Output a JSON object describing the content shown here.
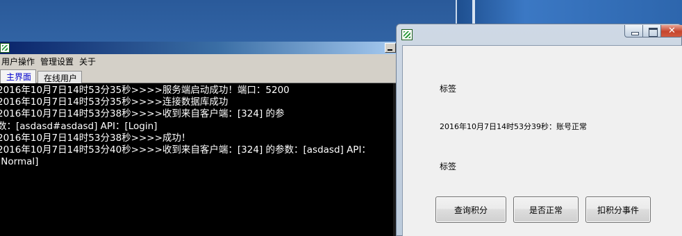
{
  "server_window": {
    "menu": [
      "用户操作",
      "管理设置",
      "关于"
    ],
    "tabs": [
      {
        "label": "主界面",
        "active": true
      },
      {
        "label": "在线用户",
        "active": false
      }
    ],
    "log_lines": [
      "2016年10月7日14时53分35秒>>>>服务端启动成功！端口：5200",
      "2016年10月7日14时53分35秒>>>>连接数据库成功",
      "2016年10月7日14时53分38秒>>>>收到来自客户端：[324] 的参",
      "数：[asdasd#asdasd] API：[Login]",
      "2016年10月7日14时53分38秒>>>>成功！",
      "2016年10月7日14时53分40秒>>>>收到来自客户端：[324] 的参数：[asdasd] API：",
      "[Normal]"
    ]
  },
  "dialog_window": {
    "label_top": "标签",
    "status_text": "2016年10月7日14时53分39秒：账号正常",
    "label_bottom": "标签",
    "buttons": {
      "query": "查询积分",
      "is_normal": "是否正常",
      "deduct": "扣积分事件"
    }
  },
  "colors": {
    "console_bg": "#000000",
    "console_text": "#ffffff",
    "active_tab_text": "#0000cc"
  }
}
